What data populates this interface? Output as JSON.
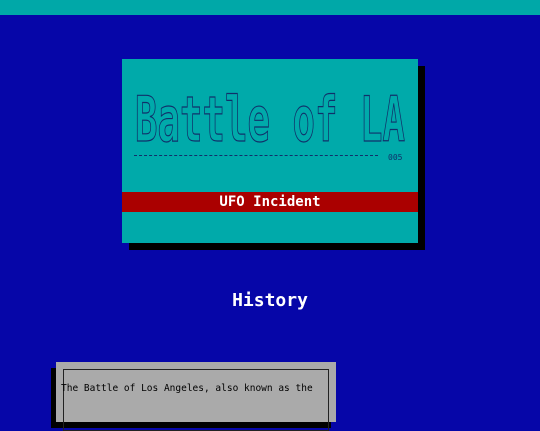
{
  "colors": {
    "background": "#0606a8",
    "top_bar": "#00a8a8",
    "card": "#00aaaa",
    "banner": "#aa0000",
    "panel": "#aaaaaa",
    "logo_ink": "#10306a"
  },
  "title_card": {
    "logo_text": "Battle of LA",
    "logo_number": "005",
    "banner_label": "UFO Incident"
  },
  "section": {
    "heading": "History"
  },
  "info_panel": {
    "text": "The Battle of Los Angeles, also known as the"
  }
}
